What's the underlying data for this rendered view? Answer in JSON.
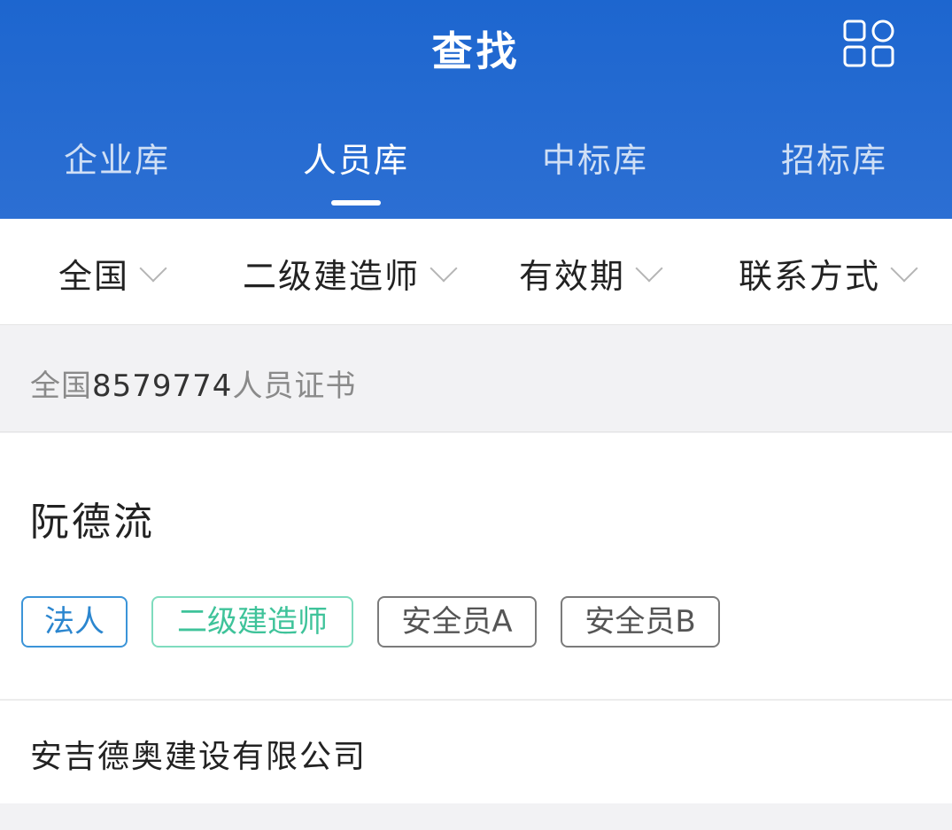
{
  "header": {
    "title": "查找",
    "menu_icon": "apps-grid-icon",
    "tabs": [
      {
        "label": "企业库",
        "active": false
      },
      {
        "label": "人员库",
        "active": true
      },
      {
        "label": "中标库",
        "active": false
      },
      {
        "label": "招标库",
        "active": false
      }
    ]
  },
  "filters": [
    {
      "label": "全国",
      "icon": "chevron-down-icon"
    },
    {
      "label": "二级建造师",
      "icon": "chevron-down-icon"
    },
    {
      "label": "有效期",
      "icon": "chevron-down-icon"
    },
    {
      "label": "联系方式",
      "icon": "chevron-down-icon"
    }
  ],
  "summary": {
    "prefix": "全国",
    "count": "8579774",
    "suffix": "人员证书"
  },
  "result": {
    "name": "阮德流",
    "tags": [
      {
        "label": "法人",
        "color": "#2b86cf"
      },
      {
        "label": "二级建造师",
        "color": "#3fc39a"
      },
      {
        "label": "安全员A",
        "color": "#555555"
      },
      {
        "label": "安全员B",
        "color": "#555555"
      }
    ],
    "company": "安吉德奥建设有限公司"
  },
  "colors": {
    "header_blue": "#1d66cf",
    "background": "#f2f2f4"
  }
}
